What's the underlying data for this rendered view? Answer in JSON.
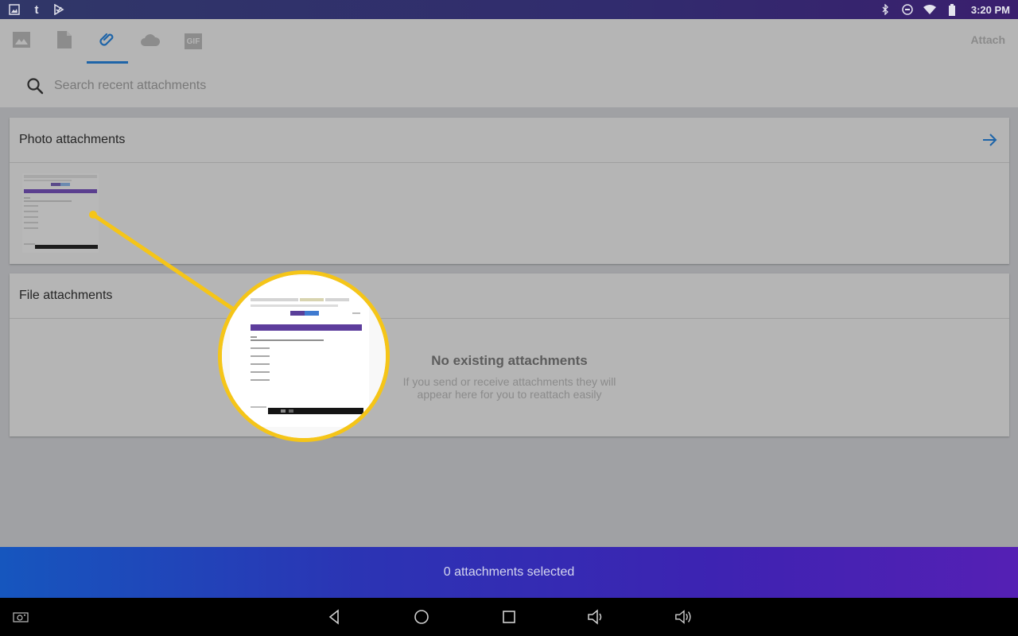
{
  "status_bar": {
    "left_icons": [
      "gallery-icon",
      "tumblr-icon",
      "play-store-icon"
    ],
    "right_icons": [
      "bluetooth-icon",
      "do-not-disturb-icon",
      "wifi-icon",
      "battery-icon"
    ],
    "time": "3:20 PM"
  },
  "header": {
    "tabs": [
      {
        "name": "photos",
        "icon": "image-icon",
        "active": false
      },
      {
        "name": "files",
        "icon": "document-icon",
        "active": false
      },
      {
        "name": "recent-attachments",
        "icon": "paperclip-icon",
        "active": true
      },
      {
        "name": "cloud",
        "icon": "cloud-icon",
        "active": false
      },
      {
        "name": "gif",
        "icon": "gif-icon",
        "label": "GIF",
        "active": false
      }
    ],
    "attach_label": "Attach",
    "search": {
      "placeholder": "Search recent attachments",
      "value": ""
    }
  },
  "colors": {
    "accent": "#1e64a8",
    "callout": "#f5c518",
    "selection_bar_start": "#1656be",
    "selection_bar_end": "#5520b4"
  },
  "photo_section": {
    "title": "Photo attachments",
    "items": [
      {
        "type": "screenshot-thumbnail"
      }
    ]
  },
  "file_section": {
    "title": "File attachments",
    "empty_title": "No existing attachments",
    "empty_line1": "If you send or receive attachments they will",
    "empty_line2": "appear here for you to reattach easily"
  },
  "selection": {
    "count": 0,
    "label": "0 attachments selected"
  },
  "nav_bar": {
    "buttons": [
      "screenshot-icon",
      "back-icon",
      "home-icon",
      "recents-icon",
      "volume-down-icon",
      "volume-up-icon"
    ]
  }
}
